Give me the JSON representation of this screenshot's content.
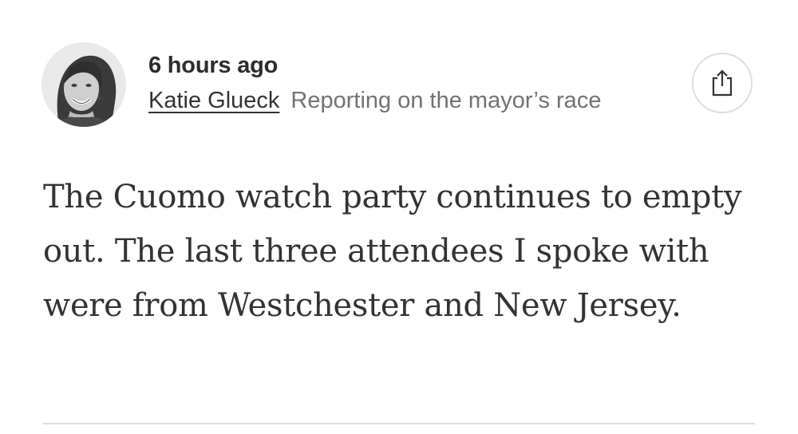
{
  "post": {
    "timestamp": "6 hours ago",
    "author": "Katie Glueck",
    "beat": "Reporting on the mayor’s race",
    "body": "The Cuomo watch party continues to empty out. The last three attendees I spoke with were from Westchester and New Jersey."
  },
  "icons": {
    "share": "share-icon",
    "avatar": "author-avatar"
  },
  "colors": {
    "text": "#333333",
    "muted": "#727272",
    "divider": "#dcdcdc"
  }
}
